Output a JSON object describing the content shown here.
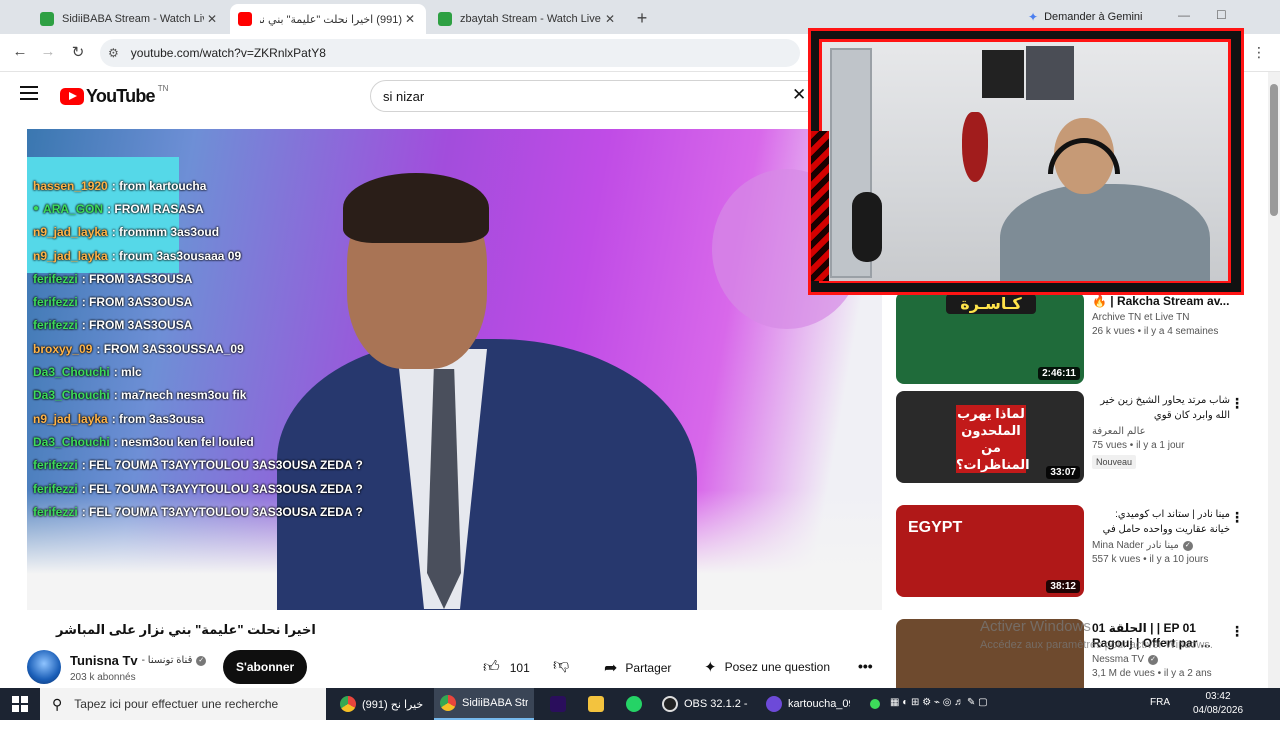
{
  "browser": {
    "tabs": [
      {
        "title": "SidiiBABA Stream - Watch Live",
        "active": false,
        "favicon_color": "#2ea043"
      },
      {
        "title": "(991) اخيرا نحلت \"عليمة\" بني نزار",
        "active": true,
        "favicon_color": "#ff0000"
      },
      {
        "title": "zbaytah Stream - Watch Live o",
        "active": false,
        "favicon_color": "#2ea043"
      }
    ],
    "new_tab": "+",
    "gemini": "Demander à Gemini",
    "url": "youtube.com/watch?v=ZKRnlxPatY8"
  },
  "youtube": {
    "logo": "YouTube",
    "country_code": "TN",
    "search_value": "si nizar"
  },
  "chat": [
    {
      "user": "hassen_1920",
      "msg": " : from kartoucha",
      "color": "#ffb347",
      "badge": false
    },
    {
      "user": "ARA_GON",
      "msg": " : FROM RASASA",
      "color": "#3ddc5a",
      "badge": true
    },
    {
      "user": "n9_jad_layka",
      "msg": " : frommm 3as3oud",
      "color": "#ffb347",
      "badge": false
    },
    {
      "user": "n9_jad_layka",
      "msg": " : froum 3as3ousaaa 09",
      "color": "#ffb347",
      "badge": false
    },
    {
      "user": "ferifezzi",
      "msg": " : FROM 3AS3OUSA",
      "color": "#3ddc5a",
      "badge": false
    },
    {
      "user": "ferifezzi",
      "msg": " : FROM 3AS3OUSA",
      "color": "#3ddc5a",
      "badge": false
    },
    {
      "user": "ferifezzi",
      "msg": " : FROM 3AS3OUSA",
      "color": "#3ddc5a",
      "badge": false
    },
    {
      "user": "broxyy_09",
      "msg": " : FROM 3AS3OUSSAA_09",
      "color": "#ffb347",
      "badge": false
    },
    {
      "user": "Da3_Chouchi",
      "msg": " : mlc",
      "color": "#3ddc5a",
      "badge": false
    },
    {
      "user": "Da3_Chouchi",
      "msg": " : ma7nech nesm3ou fik",
      "color": "#3ddc5a",
      "badge": false
    },
    {
      "user": "n9_jad_layka",
      "msg": " : from 3as3ousa",
      "color": "#ffb347",
      "badge": false
    },
    {
      "user": "Da3_Chouchi",
      "msg": " : nesm3ou ken fel louled",
      "color": "#3ddc5a",
      "badge": false
    },
    {
      "user": "ferifezzi",
      "msg": " : FEL 7OUMA T3AYYTOULOU 3AS3OUSA ZEDA ?",
      "color": "#3ddc5a",
      "badge": false
    },
    {
      "user": "ferifezzi",
      "msg": " : FEL 7OUMA T3AYYTOULOU 3AS3OUSA ZEDA ?",
      "color": "#3ddc5a",
      "badge": false
    },
    {
      "user": "ferifezzi",
      "msg": " : FEL 7OUMA T3AYYTOULOU 3AS3OUSA ZEDA ?",
      "color": "#3ddc5a",
      "badge": false
    }
  ],
  "video": {
    "title": "اخيرا نحلت \"عليمة\" بني نزار على المباشر",
    "channel_name": "Tunisna Tv",
    "channel_name_ar": "- قناة تونسنا",
    "subscribers": "203 k abonnés",
    "subscribe_label": "S'abonner",
    "likes": "101",
    "share_label": "Partager",
    "ask_label": "Posez une question"
  },
  "recommendations": [
    {
      "title": "🔥 | Rakcha Stream av...",
      "channel": "Archive TN et Live TN",
      "verified": false,
      "views": "26 k vues • il y a 4 semaines",
      "duration": "2:46:11",
      "badge": "",
      "rtl": false,
      "thumb_text": "كـاسـرة",
      "thumb_bg": "#1f6b3a"
    },
    {
      "title": "شاب مرتد يحاور الشيخ زين خير الله وابرد كان قوي",
      "channel": "عالم المعرفة",
      "verified": false,
      "views": "75 vues • il y a 1 jour",
      "duration": "33:07",
      "badge": "Nouveau",
      "rtl": true,
      "thumb_text": "لماذا يهرب الملحدون من المناظرات؟",
      "thumb_bg": "#2a2a2a"
    },
    {
      "title": "مينا نادر | ستاند اب كوميدي: خيانة عقاريت وواحده حامل في خمس...",
      "channel": "Mina Nader مينا نادر",
      "verified": true,
      "views": "557 k vues • il y a 10 jours",
      "duration": "38:12",
      "badge": "",
      "rtl": true,
      "thumb_text": "EGYPT",
      "thumb_bg": "#b01818"
    },
    {
      "title": "الحلقة 01 | | EP 01 Ragouj | Offert par ... فرق",
      "channel": "Nessma TV",
      "verified": true,
      "views": "3,1 M de vues • il y a 2 ans",
      "duration": "",
      "badge": "",
      "rtl": false,
      "thumb_text": "",
      "thumb_bg": "#6e4a2e"
    }
  ],
  "watermark": {
    "line1": "Activer Windows",
    "line2": "Accédez aux paramètres pour activer Windows."
  },
  "taskbar": {
    "search_placeholder": "Tapez ici pour effectuer une recherche",
    "items": [
      {
        "label": "(991) اخيرا نح...",
        "color": "#e8453c"
      },
      {
        "label": "SidiiBABA Str...",
        "color": "#e8453c"
      },
      {
        "label": "OBS 32.1.2 - ...",
        "color": "#333"
      },
      {
        "label": "kartoucha_09,...",
        "color": "#6d4ad8"
      }
    ],
    "language": "FRA",
    "time": "03:42",
    "date": "04/08/2026"
  }
}
